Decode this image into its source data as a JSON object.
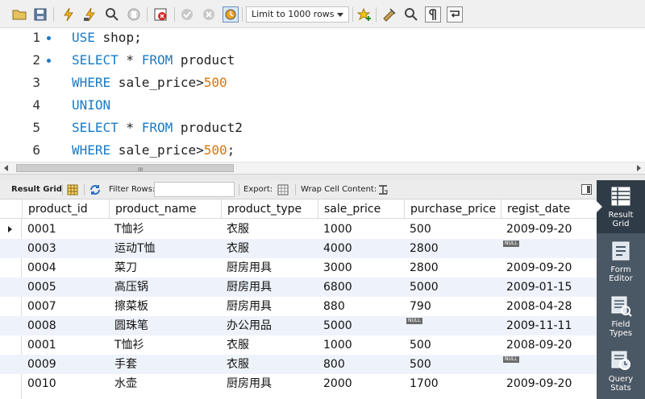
{
  "toolbar": {
    "limit_label": "Limit to 1000 rows",
    "icons": [
      "open-folder-icon",
      "save-icon",
      "execute-icon",
      "execute-current-icon",
      "explain-icon",
      "stop-icon",
      "toggle-error-icon",
      "commit-icon",
      "rollback-icon",
      "autocommit-icon",
      "add-snippet-icon",
      "beautify-icon",
      "find-icon",
      "invisible-chars-icon",
      "wrap-icon"
    ]
  },
  "editor": {
    "lines": [
      {
        "num": "1",
        "marker": true,
        "tokens": [
          {
            "t": "USE",
            "k": "kw"
          },
          {
            "t": " shop;",
            "k": ""
          }
        ]
      },
      {
        "num": "2",
        "marker": true,
        "tokens": [
          {
            "t": "SELECT",
            "k": "kw"
          },
          {
            "t": " * ",
            "k": ""
          },
          {
            "t": "FROM",
            "k": "kw"
          },
          {
            "t": " product",
            "k": ""
          }
        ]
      },
      {
        "num": "3",
        "marker": false,
        "tokens": [
          {
            "t": "WHERE",
            "k": "kw"
          },
          {
            "t": " sale_price>",
            "k": ""
          },
          {
            "t": "500",
            "k": "nm"
          }
        ]
      },
      {
        "num": "4",
        "marker": false,
        "tokens": [
          {
            "t": "UNION",
            "k": "kw"
          }
        ]
      },
      {
        "num": "5",
        "marker": false,
        "tokens": [
          {
            "t": "SELECT",
            "k": "kw"
          },
          {
            "t": " * ",
            "k": ""
          },
          {
            "t": "FROM",
            "k": "kw"
          },
          {
            "t": " product2",
            "k": ""
          }
        ]
      },
      {
        "num": "6",
        "marker": false,
        "tokens": [
          {
            "t": "WHERE",
            "k": "kw"
          },
          {
            "t": " sale_price>",
            "k": ""
          },
          {
            "t": "500",
            "k": "nm"
          },
          {
            "t": ";",
            "k": ""
          }
        ]
      }
    ],
    "scroll_grip": "III"
  },
  "result_toolbar": {
    "result_grid": "Result Grid",
    "filter_rows": "Filter Rows:",
    "filter_value": "",
    "export": "Export:",
    "wrap_cell": "Wrap Cell Content:"
  },
  "grid": {
    "columns": [
      "product_id",
      "product_name",
      "product_type",
      "sale_price",
      "purchase_price",
      "regist_date"
    ],
    "null_label": "NULL",
    "rows": [
      [
        "0001",
        "T恤衫",
        "衣服",
        "1000",
        "500",
        "2009-09-20"
      ],
      [
        "0003",
        "运动T恤",
        "衣服",
        "4000",
        "2800",
        null
      ],
      [
        "0004",
        "菜刀",
        "厨房用具",
        "3000",
        "2800",
        "2009-09-20"
      ],
      [
        "0005",
        "高压锅",
        "厨房用具",
        "6800",
        "5000",
        "2009-01-15"
      ],
      [
        "0007",
        "擦菜板",
        "厨房用具",
        "880",
        "790",
        "2008-04-28"
      ],
      [
        "0008",
        "圆珠笔",
        "办公用品",
        "5000",
        null,
        "2009-11-11"
      ],
      [
        "0001",
        "T恤衫",
        "衣服",
        "1000",
        "500",
        "2008-09-20"
      ],
      [
        "0009",
        "手套",
        "衣服",
        "800",
        "500",
        null
      ],
      [
        "0010",
        "水壶",
        "厨房用具",
        "2000",
        "1700",
        "2009-09-20"
      ]
    ]
  },
  "side_panel": {
    "items": [
      {
        "label": "Result\nGrid",
        "icon": "result-grid-icon",
        "active": true
      },
      {
        "label": "Form\nEditor",
        "icon": "form-editor-icon",
        "active": false
      },
      {
        "label": "Field\nTypes",
        "icon": "field-types-icon",
        "active": false
      },
      {
        "label": "Query\nStats",
        "icon": "query-stats-icon",
        "active": false
      }
    ]
  },
  "colors": {
    "keyword": "#1a7ac4",
    "number": "#d8740c",
    "side_panel": "#4a5764"
  }
}
